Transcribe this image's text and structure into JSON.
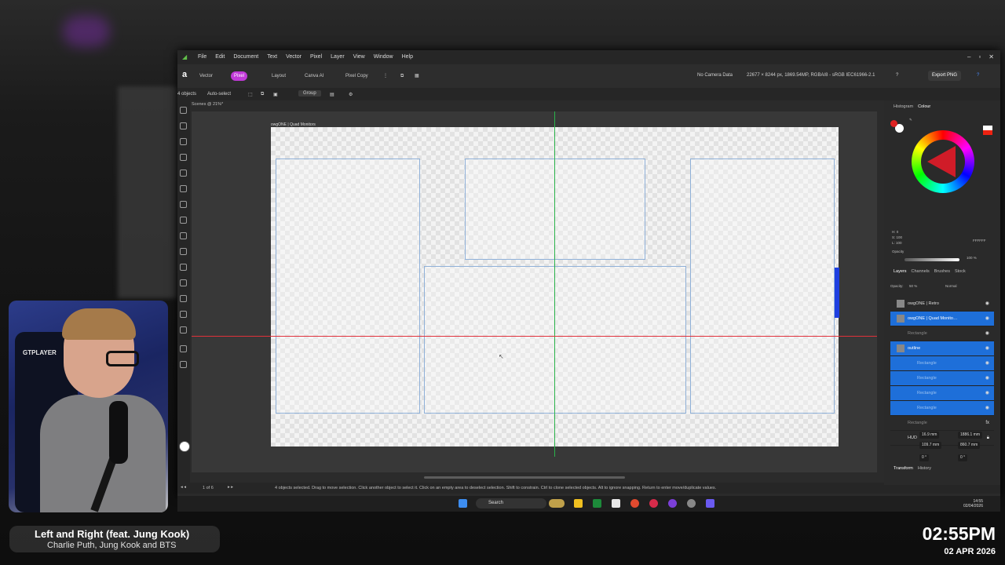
{
  "app": {
    "menus": [
      "File",
      "Edit",
      "Document",
      "Text",
      "Vector",
      "Pixel",
      "Layer",
      "View",
      "Window",
      "Help"
    ],
    "personas": {
      "vector": "Vector",
      "pixel": "Pixel",
      "layout": "Layout",
      "canva_ai": "Canva AI",
      "pixel_copy": "Pixel Copy"
    },
    "camera_info": "No Camera Data",
    "doc_info": "22677 × 8244 px, 1869.54MP, RGBA/8 - sRGB IEC61966-2.1",
    "export_label": "Export PNG",
    "context": {
      "count": "4 objects",
      "auto_select": "Auto-select",
      "group": "Group"
    },
    "tab_title": "Scenes @ 21%*",
    "doc_title": "owgONE | Quad Monitors",
    "status_page": "1 of 6",
    "status_message": "4 objects selected. Drag to move selection. Click another object to select it. Click on an empty area to deselect selection. Shift to constrain. Ctrl to clone selected objects. Alt to ignore snapping. Return to enter move/duplicate values."
  },
  "color_panel": {
    "tabs": [
      "Histogram",
      "Colour"
    ],
    "hex": "FFFFFF",
    "opacity_label": "Opacity",
    "opacity_value": "100 %",
    "hsl": [
      "H: 0",
      "S: 100",
      "L: 100"
    ]
  },
  "layers_panel": {
    "tabs": [
      "Layers",
      "Channels",
      "Brushes",
      "Stock"
    ],
    "opacity": "50 %",
    "blend": "Normal",
    "items": [
      {
        "name": "owgONE | Retro",
        "state": "normal"
      },
      {
        "name": "owgONE | Quad Monito…",
        "state": "selected"
      },
      {
        "name": "Rectangle",
        "state": "dim"
      },
      {
        "name": "outline",
        "state": "selected"
      },
      {
        "name": "Rectangle",
        "state": "sub"
      },
      {
        "name": "Rectangle",
        "state": "sub"
      },
      {
        "name": "Rectangle",
        "state": "sub"
      },
      {
        "name": "Rectangle",
        "state": "sub"
      },
      {
        "name": "Rectangle",
        "state": "dim"
      },
      {
        "name": "HUD",
        "state": "normal"
      }
    ]
  },
  "transform_panel": {
    "tabs": [
      "Transform",
      "History"
    ],
    "x": "16.9 mm",
    "y": "109.7 mm",
    "w": "1886.1 mm",
    "h": "860.7 mm",
    "r": "0 °",
    "s": "0 °"
  },
  "taskbar": {
    "search": "Search",
    "time": "14:55",
    "date": "02/04/2026"
  },
  "overlay": {
    "song_title": "Left and Right (feat. Jung Kook)",
    "song_artist": "Charlie Puth, Jung Kook and BTS",
    "clock_time": "02:55PM",
    "clock_date": "02 APR 2026",
    "chair_text": "GTPLAYER"
  },
  "colors": {
    "accent": "#c13ad8",
    "selection": "#1e6fd9",
    "guide_v": "#2ab34a",
    "guide_h": "#e0303a"
  }
}
